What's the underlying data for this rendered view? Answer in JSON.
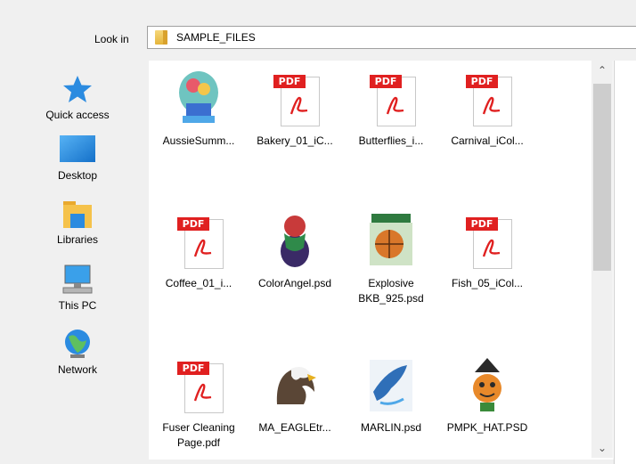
{
  "lookin": {
    "label": "Look in",
    "path": "SAMPLE_FILES"
  },
  "places": [
    {
      "label": "Quick access",
      "icon": "star-icon"
    },
    {
      "label": "Desktop",
      "icon": "desktop-icon"
    },
    {
      "label": "Libraries",
      "icon": "libraries-folder-icon"
    },
    {
      "label": "This PC",
      "icon": "computer-icon"
    },
    {
      "label": "Network",
      "icon": "network-globe-icon"
    }
  ],
  "files": [
    {
      "name": "AussieSumm...",
      "type": "image"
    },
    {
      "name": "Bakery_01_iC...",
      "type": "pdf"
    },
    {
      "name": "Butterflies_i...",
      "type": "pdf"
    },
    {
      "name": "Carnival_iCol...",
      "type": "pdf"
    },
    {
      "name": "Coffee_01_i...",
      "type": "pdf"
    },
    {
      "name": "ColorAngel.psd",
      "type": "image"
    },
    {
      "name": "Explosive BKB_925.psd",
      "type": "image"
    },
    {
      "name": "Fish_05_iCol...",
      "type": "pdf"
    },
    {
      "name": "Fuser Cleaning Page.pdf",
      "type": "pdf"
    },
    {
      "name": "MA_EAGLEtr...",
      "type": "image"
    },
    {
      "name": "MARLIN.psd",
      "type": "image"
    },
    {
      "name": "PMPK_HAT.PSD",
      "type": "image"
    }
  ],
  "pdf_tag": "PDF",
  "colors": {
    "pdf_red": "#e02020",
    "accent_blue": "#2b8be0"
  }
}
